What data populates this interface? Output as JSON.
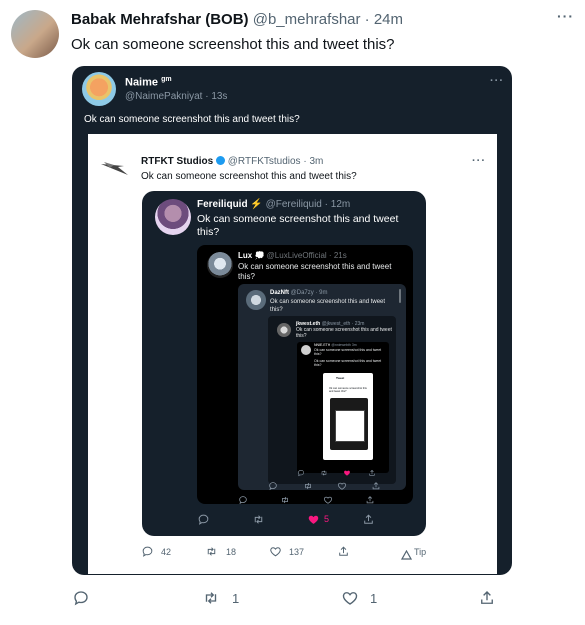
{
  "outer": {
    "name": "Babak Mehrafshar (BOB)",
    "handle": "@b_mehrafshar",
    "separator": "·",
    "time": "24m",
    "text": "Ok can someone screenshot this and tweet this?",
    "retweets": "1",
    "likes": "1"
  },
  "naime": {
    "name": "Naime",
    "name_badge": "gm",
    "handle": "@NaimePakniyat",
    "separator": "·",
    "time": "13s",
    "text": "Ok can someone screenshot this and tweet this?"
  },
  "rtfkt": {
    "name": "RTFKT Studios",
    "handle": "@RTFKTstudios",
    "separator": "·",
    "time": "3m",
    "text": "Ok can someone screenshot this and tweet this?",
    "replies": "42",
    "retweets": "18",
    "likes": "137",
    "tip_label": "Tip"
  },
  "fereil": {
    "name": "Fereiliquid",
    "badge": "⚡",
    "handle": "@Fereiliquid",
    "separator": "·",
    "time": "12m",
    "text": "Ok can someone screenshot this and tweet this?",
    "likes": "5"
  },
  "lux": {
    "name": "Lux",
    "badge": "💭",
    "handle": "@LuxLiveOfficial",
    "separator": "·",
    "time": "21s",
    "text": "Ok can someone screenshot this and tweet this?"
  },
  "daz": {
    "name": "DazNft",
    "handle": "@Da7zy",
    "separator": "·",
    "time": "9m",
    "text": "Ok can someone screenshot this and tweet this?"
  },
  "jk": {
    "name": "jkwest.eth",
    "handle": "@jkwest_eth",
    "separator": "·",
    "time": "23m",
    "text": "Ok can someone screenshot this and tweet this?"
  },
  "tiny": {
    "name": "NNIE.ETH",
    "handle": "@nniewebth",
    "time": "3m",
    "text": "Ok can someone screenshot this and tweet this?",
    "inner_text": "Ok can someone screenshot this and tweet this?",
    "deep_title": "Tweet",
    "deep_text": "Ok can someone screenshot this and tweet this?"
  },
  "icons": {
    "reply": "reply-icon",
    "retweet": "retweet-icon",
    "like": "heart-icon",
    "share": "share-icon",
    "more": "more-icon"
  },
  "colors": {
    "text": "#0f1419",
    "muted": "#536471",
    "verified": "#1d9bf0",
    "like_active": "#f91880",
    "dark_panel": "#15202b",
    "black_panel": "#000000"
  }
}
